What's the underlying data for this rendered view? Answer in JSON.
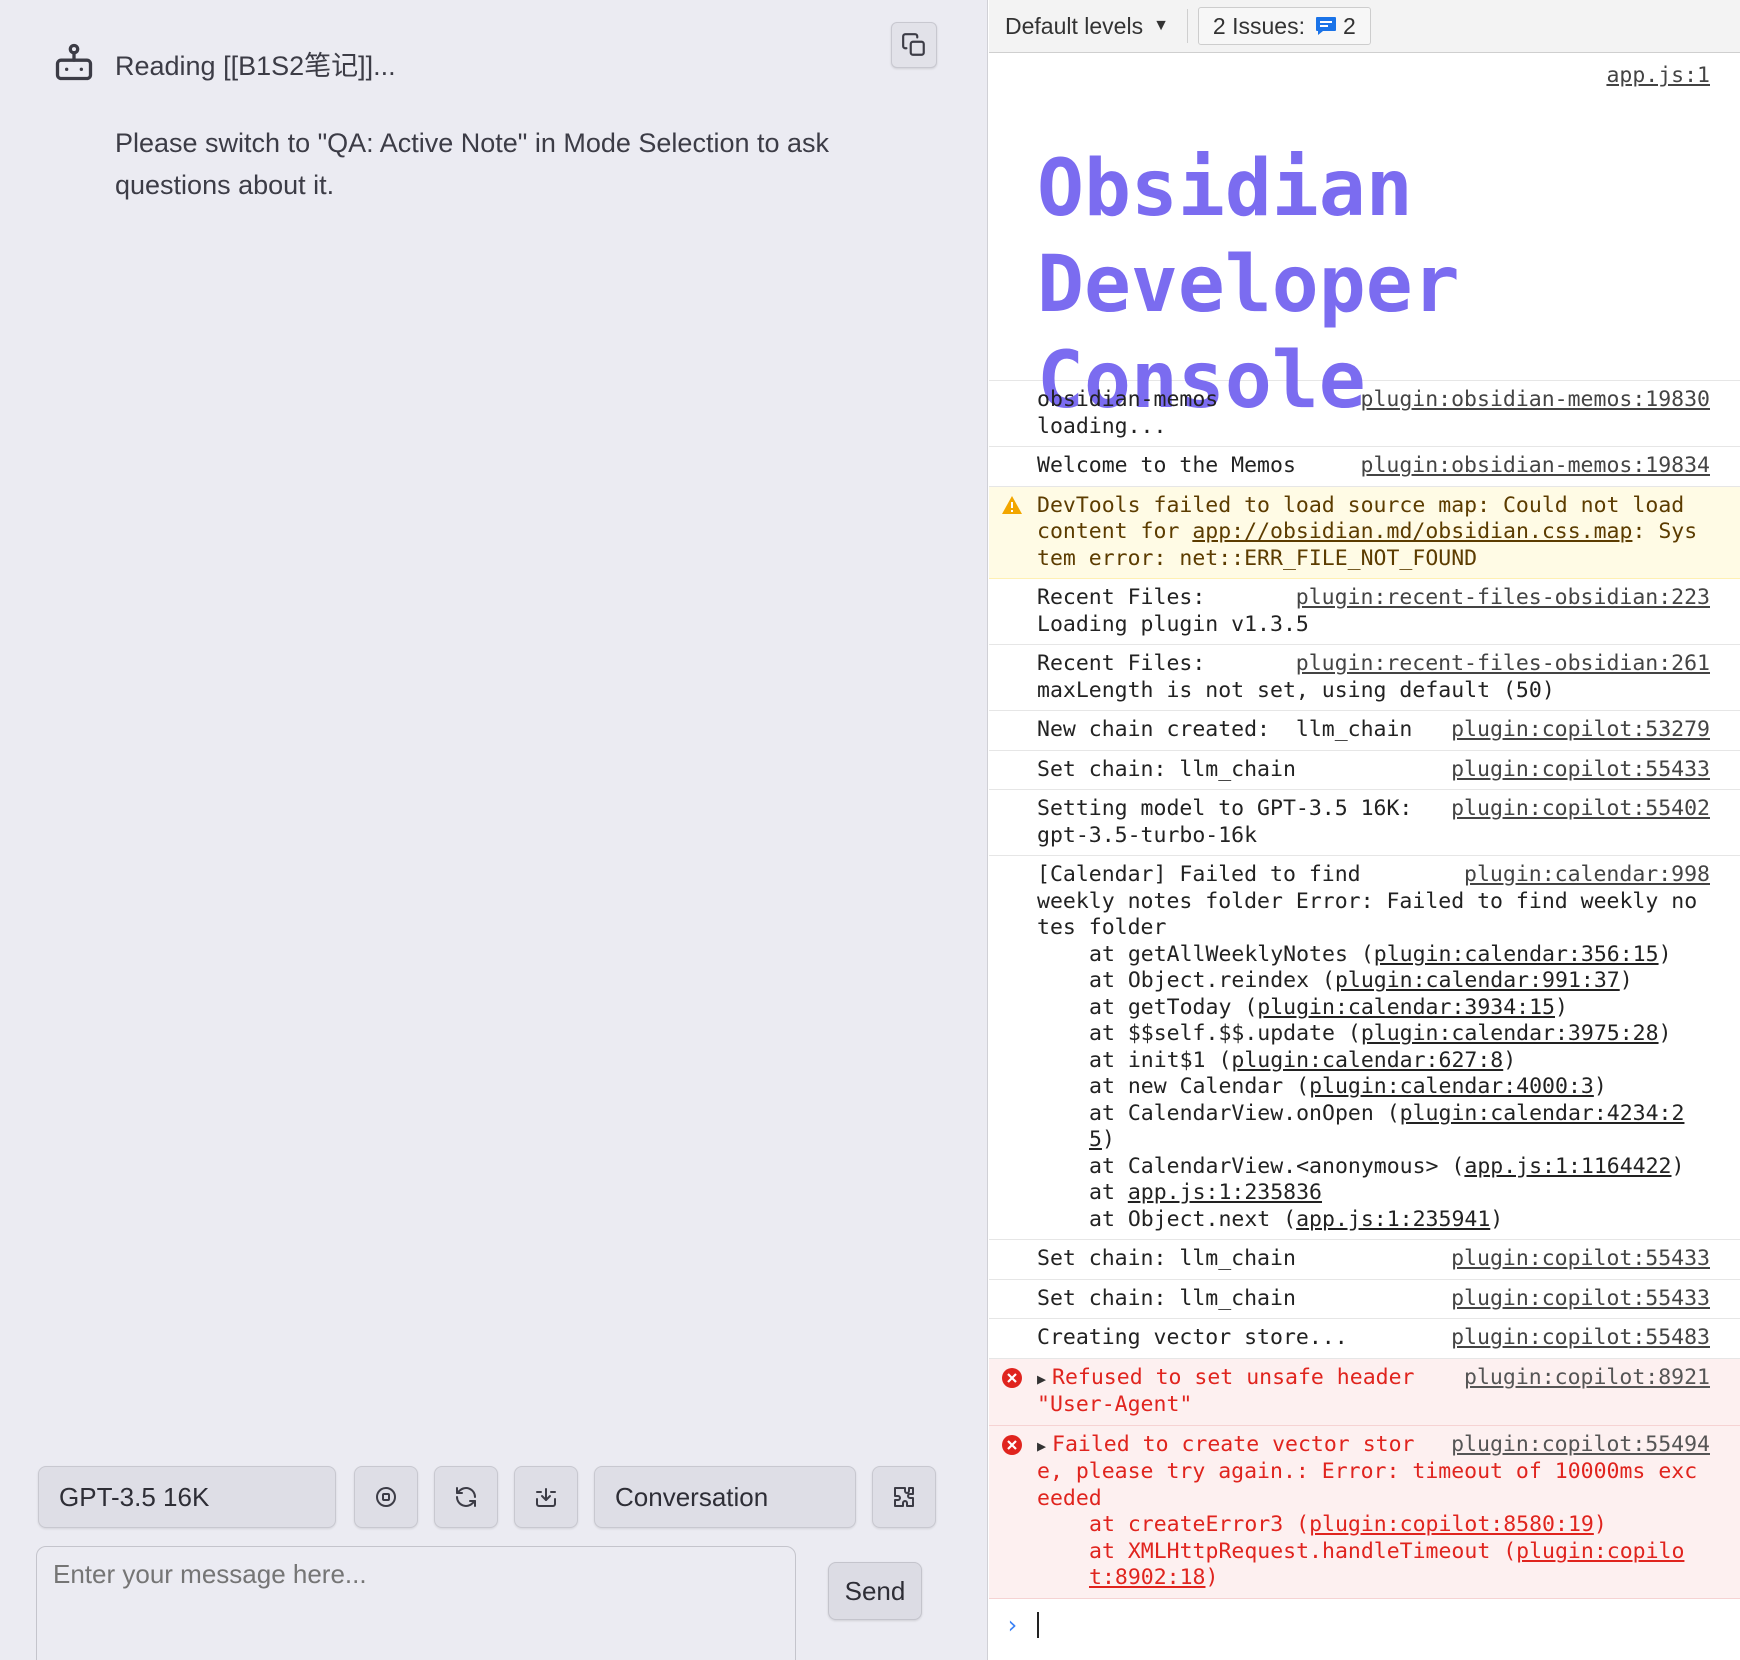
{
  "chat": {
    "message_title": "Reading [[B1S2笔记]]...",
    "message_body": "Please switch to \"QA: Active Note\" in Mode Selection to ask questions about it.",
    "model_selected": "GPT-3.5 16K",
    "mode_selected": "Conversation",
    "input_placeholder": "Enter your message here...",
    "send_label": "Send",
    "icons": [
      "copy-icon",
      "bot-icon",
      "stop-icon",
      "refresh-icon",
      "download-icon",
      "puzzle-icon"
    ]
  },
  "console": {
    "toolbar": {
      "levels_label": "Default levels",
      "issues_label": "2 Issues:",
      "issues_count": "2"
    },
    "banner": {
      "source": "app.js:1",
      "text": "Obsidian\nDeveloper\nConsole"
    },
    "messages": [
      {
        "level": "log",
        "text": "obsidian-memos\nloading...",
        "source": "plugin:obsidian-memos:19830"
      },
      {
        "level": "log",
        "text": "Welcome to the Memos",
        "source": "plugin:obsidian-memos:19834"
      },
      {
        "level": "warn",
        "text_before": "DevTools failed to load source map: Could not load content for ",
        "link": "app://obsidian.md/obsidian.css.map",
        "text_after": ": System error: net::ERR_FILE_NOT_FOUND"
      },
      {
        "level": "log",
        "text": "Recent Files:\nLoading plugin v1.3.5",
        "source": "plugin:recent-files-obsidian:223"
      },
      {
        "level": "log",
        "text": "Recent Files:\nmaxLength is not set, using default (50)",
        "source": "plugin:recent-files-obsidian:261"
      },
      {
        "level": "log",
        "text": "New chain created:  llm_chain",
        "source": "plugin:copilot:53279"
      },
      {
        "level": "log",
        "text": "Set chain: llm_chain",
        "source": "plugin:copilot:55433"
      },
      {
        "level": "log",
        "text": "Setting model to GPT-3.5 16K:\ngpt-3.5-turbo-16k",
        "source": "plugin:copilot:55402"
      },
      {
        "level": "log",
        "text": "[Calendar] Failed to find\nweekly notes folder Error: Failed to find weekly notes folder",
        "source": "plugin:calendar:998",
        "stack": [
          {
            "pre": "at getAllWeeklyNotes (",
            "link": "plugin:calendar:356:15",
            "post": ")"
          },
          {
            "pre": "at Object.reindex (",
            "link": "plugin:calendar:991:37",
            "post": ")"
          },
          {
            "pre": "at getToday (",
            "link": "plugin:calendar:3934:15",
            "post": ")"
          },
          {
            "pre": "at $$self.$$.update (",
            "link": "plugin:calendar:3975:28",
            "post": ")"
          },
          {
            "pre": "at init$1 (",
            "link": "plugin:calendar:627:8",
            "post": ")"
          },
          {
            "pre": "at new Calendar (",
            "link": "plugin:calendar:4000:3",
            "post": ")"
          },
          {
            "pre": "at CalendarView.onOpen (",
            "link": "plugin:calendar:4234:25",
            "post": ")"
          },
          {
            "pre": "at CalendarView.<anonymous> (",
            "link": "app.js:1:1164422",
            "post": ")"
          },
          {
            "pre": "at ",
            "link": "app.js:1:235836",
            "post": ""
          },
          {
            "pre": "at Object.next (",
            "link": "app.js:1:235941",
            "post": ")"
          }
        ]
      },
      {
        "level": "log",
        "text": "Set chain: llm_chain",
        "source": "plugin:copilot:55433"
      },
      {
        "level": "log",
        "text": "Set chain: llm_chain",
        "source": "plugin:copilot:55433"
      },
      {
        "level": "log",
        "text": "Creating vector store...",
        "source": "plugin:copilot:55483"
      },
      {
        "level": "error",
        "text": "Refused to set unsafe header \"User-Agent\"",
        "source": "plugin:copilot:8921"
      },
      {
        "level": "error",
        "text": "Failed to create vector store, please try again.: Error: timeout of 10000ms exceeded",
        "source": "plugin:copilot:55494",
        "stack": [
          {
            "pre": "at createError3 (",
            "link": "plugin:copilot:8580:19",
            "post": ")"
          },
          {
            "pre": "at XMLHttpRequest.handleTimeout (",
            "link": "plugin:copilot:8902:18",
            "post": ")"
          }
        ]
      }
    ],
    "colors": {
      "banner": "#7b6cf0",
      "error_text": "#e0241e",
      "error_bg": "#fdf0f0",
      "warn_bg": "#fffbe5",
      "issues_icon": "#1a73e8"
    }
  }
}
